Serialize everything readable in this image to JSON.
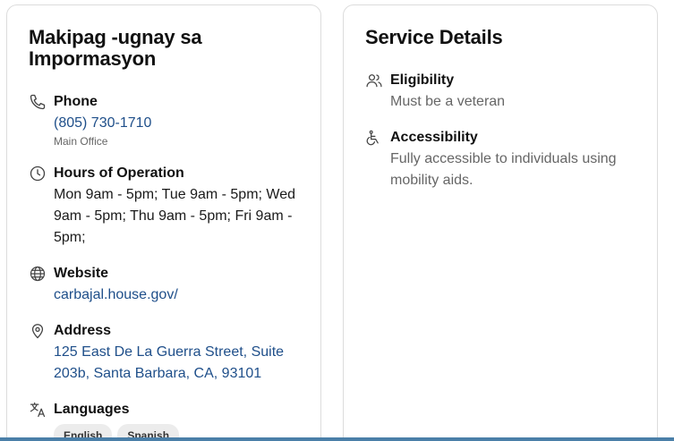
{
  "contact": {
    "title": "Makipag -ugnay sa Impormasyon",
    "phone": {
      "label": "Phone",
      "value": "(805) 730-1710",
      "note": "Main Office",
      "icon": "phone-icon"
    },
    "hours": {
      "label": "Hours of Operation",
      "value": "Mon 9am - 5pm; Tue 9am - 5pm; Wed 9am - 5pm; Thu 9am - 5pm; Fri 9am - 5pm;",
      "icon": "clock-icon"
    },
    "website": {
      "label": "Website",
      "value": "carbajal.house.gov/",
      "icon": "globe-icon"
    },
    "address": {
      "label": "Address",
      "value": "125 East De La Guerra Street, Suite 203b, Santa Barbara, CA, 93101",
      "icon": "location-pin-icon"
    },
    "languages": {
      "label": "Languages",
      "items": [
        "English",
        "Spanish"
      ],
      "icon": "translate-icon"
    }
  },
  "service": {
    "title": "Service Details",
    "eligibility": {
      "label": "Eligibility",
      "value": "Must be a veteran",
      "icon": "people-icon"
    },
    "accessibility": {
      "label": "Accessibility",
      "value": "Fully accessible to individuals using mobility aids.",
      "icon": "accessibility-icon"
    }
  },
  "colors": {
    "link": "#1f4f8a",
    "accent_bar": "#4a7fa8",
    "border": "#dcdcdc"
  }
}
